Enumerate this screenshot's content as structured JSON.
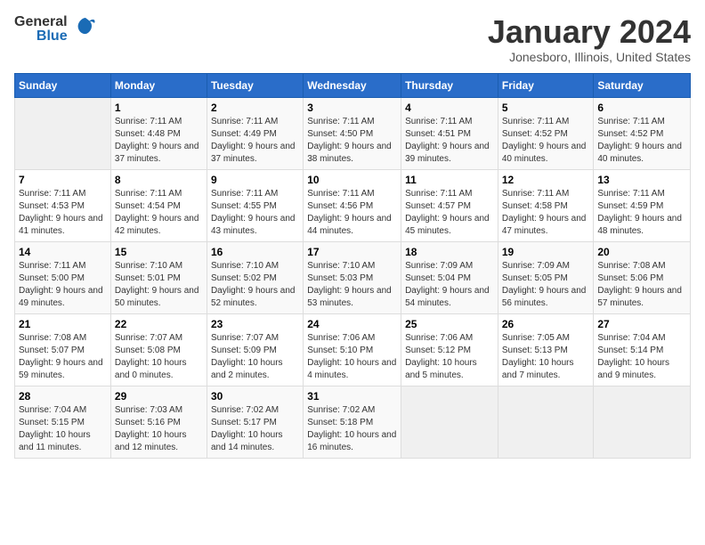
{
  "header": {
    "logo_general": "General",
    "logo_blue": "Blue",
    "month_title": "January 2024",
    "location": "Jonesboro, Illinois, United States"
  },
  "days_of_week": [
    "Sunday",
    "Monday",
    "Tuesday",
    "Wednesday",
    "Thursday",
    "Friday",
    "Saturday"
  ],
  "weeks": [
    [
      {
        "day": "",
        "sunrise": "",
        "sunset": "",
        "daylight": "",
        "empty": true
      },
      {
        "day": "1",
        "sunrise": "Sunrise: 7:11 AM",
        "sunset": "Sunset: 4:48 PM",
        "daylight": "Daylight: 9 hours and 37 minutes."
      },
      {
        "day": "2",
        "sunrise": "Sunrise: 7:11 AM",
        "sunset": "Sunset: 4:49 PM",
        "daylight": "Daylight: 9 hours and 37 minutes."
      },
      {
        "day": "3",
        "sunrise": "Sunrise: 7:11 AM",
        "sunset": "Sunset: 4:50 PM",
        "daylight": "Daylight: 9 hours and 38 minutes."
      },
      {
        "day": "4",
        "sunrise": "Sunrise: 7:11 AM",
        "sunset": "Sunset: 4:51 PM",
        "daylight": "Daylight: 9 hours and 39 minutes."
      },
      {
        "day": "5",
        "sunrise": "Sunrise: 7:11 AM",
        "sunset": "Sunset: 4:52 PM",
        "daylight": "Daylight: 9 hours and 40 minutes."
      },
      {
        "day": "6",
        "sunrise": "Sunrise: 7:11 AM",
        "sunset": "Sunset: 4:52 PM",
        "daylight": "Daylight: 9 hours and 40 minutes."
      }
    ],
    [
      {
        "day": "7",
        "sunrise": "Sunrise: 7:11 AM",
        "sunset": "Sunset: 4:53 PM",
        "daylight": "Daylight: 9 hours and 41 minutes."
      },
      {
        "day": "8",
        "sunrise": "Sunrise: 7:11 AM",
        "sunset": "Sunset: 4:54 PM",
        "daylight": "Daylight: 9 hours and 42 minutes."
      },
      {
        "day": "9",
        "sunrise": "Sunrise: 7:11 AM",
        "sunset": "Sunset: 4:55 PM",
        "daylight": "Daylight: 9 hours and 43 minutes."
      },
      {
        "day": "10",
        "sunrise": "Sunrise: 7:11 AM",
        "sunset": "Sunset: 4:56 PM",
        "daylight": "Daylight: 9 hours and 44 minutes."
      },
      {
        "day": "11",
        "sunrise": "Sunrise: 7:11 AM",
        "sunset": "Sunset: 4:57 PM",
        "daylight": "Daylight: 9 hours and 45 minutes."
      },
      {
        "day": "12",
        "sunrise": "Sunrise: 7:11 AM",
        "sunset": "Sunset: 4:58 PM",
        "daylight": "Daylight: 9 hours and 47 minutes."
      },
      {
        "day": "13",
        "sunrise": "Sunrise: 7:11 AM",
        "sunset": "Sunset: 4:59 PM",
        "daylight": "Daylight: 9 hours and 48 minutes."
      }
    ],
    [
      {
        "day": "14",
        "sunrise": "Sunrise: 7:11 AM",
        "sunset": "Sunset: 5:00 PM",
        "daylight": "Daylight: 9 hours and 49 minutes."
      },
      {
        "day": "15",
        "sunrise": "Sunrise: 7:10 AM",
        "sunset": "Sunset: 5:01 PM",
        "daylight": "Daylight: 9 hours and 50 minutes."
      },
      {
        "day": "16",
        "sunrise": "Sunrise: 7:10 AM",
        "sunset": "Sunset: 5:02 PM",
        "daylight": "Daylight: 9 hours and 52 minutes."
      },
      {
        "day": "17",
        "sunrise": "Sunrise: 7:10 AM",
        "sunset": "Sunset: 5:03 PM",
        "daylight": "Daylight: 9 hours and 53 minutes."
      },
      {
        "day": "18",
        "sunrise": "Sunrise: 7:09 AM",
        "sunset": "Sunset: 5:04 PM",
        "daylight": "Daylight: 9 hours and 54 minutes."
      },
      {
        "day": "19",
        "sunrise": "Sunrise: 7:09 AM",
        "sunset": "Sunset: 5:05 PM",
        "daylight": "Daylight: 9 hours and 56 minutes."
      },
      {
        "day": "20",
        "sunrise": "Sunrise: 7:08 AM",
        "sunset": "Sunset: 5:06 PM",
        "daylight": "Daylight: 9 hours and 57 minutes."
      }
    ],
    [
      {
        "day": "21",
        "sunrise": "Sunrise: 7:08 AM",
        "sunset": "Sunset: 5:07 PM",
        "daylight": "Daylight: 9 hours and 59 minutes."
      },
      {
        "day": "22",
        "sunrise": "Sunrise: 7:07 AM",
        "sunset": "Sunset: 5:08 PM",
        "daylight": "Daylight: 10 hours and 0 minutes."
      },
      {
        "day": "23",
        "sunrise": "Sunrise: 7:07 AM",
        "sunset": "Sunset: 5:09 PM",
        "daylight": "Daylight: 10 hours and 2 minutes."
      },
      {
        "day": "24",
        "sunrise": "Sunrise: 7:06 AM",
        "sunset": "Sunset: 5:10 PM",
        "daylight": "Daylight: 10 hours and 4 minutes."
      },
      {
        "day": "25",
        "sunrise": "Sunrise: 7:06 AM",
        "sunset": "Sunset: 5:12 PM",
        "daylight": "Daylight: 10 hours and 5 minutes."
      },
      {
        "day": "26",
        "sunrise": "Sunrise: 7:05 AM",
        "sunset": "Sunset: 5:13 PM",
        "daylight": "Daylight: 10 hours and 7 minutes."
      },
      {
        "day": "27",
        "sunrise": "Sunrise: 7:04 AM",
        "sunset": "Sunset: 5:14 PM",
        "daylight": "Daylight: 10 hours and 9 minutes."
      }
    ],
    [
      {
        "day": "28",
        "sunrise": "Sunrise: 7:04 AM",
        "sunset": "Sunset: 5:15 PM",
        "daylight": "Daylight: 10 hours and 11 minutes."
      },
      {
        "day": "29",
        "sunrise": "Sunrise: 7:03 AM",
        "sunset": "Sunset: 5:16 PM",
        "daylight": "Daylight: 10 hours and 12 minutes."
      },
      {
        "day": "30",
        "sunrise": "Sunrise: 7:02 AM",
        "sunset": "Sunset: 5:17 PM",
        "daylight": "Daylight: 10 hours and 14 minutes."
      },
      {
        "day": "31",
        "sunrise": "Sunrise: 7:02 AM",
        "sunset": "Sunset: 5:18 PM",
        "daylight": "Daylight: 10 hours and 16 minutes."
      },
      {
        "day": "",
        "sunrise": "",
        "sunset": "",
        "daylight": "",
        "empty": true
      },
      {
        "day": "",
        "sunrise": "",
        "sunset": "",
        "daylight": "",
        "empty": true
      },
      {
        "day": "",
        "sunrise": "",
        "sunset": "",
        "daylight": "",
        "empty": true
      }
    ]
  ]
}
